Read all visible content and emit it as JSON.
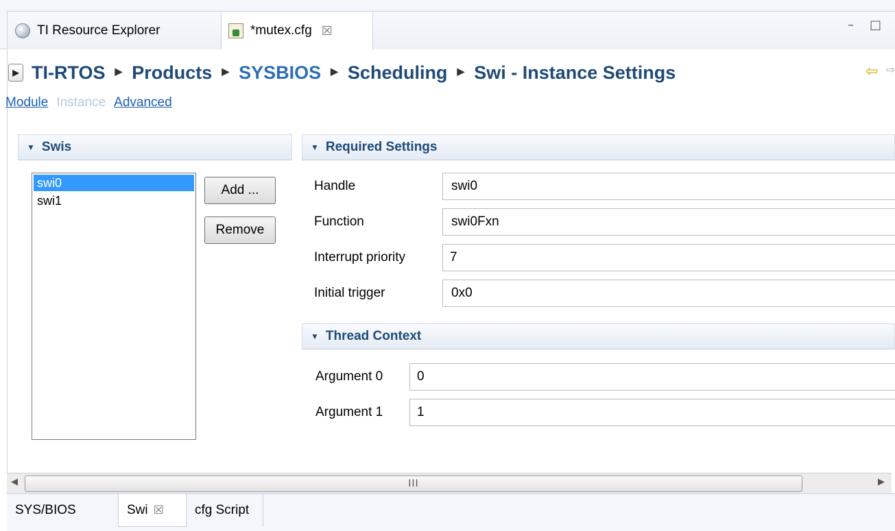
{
  "tabs": {
    "resource_explorer": "TI Resource Explorer",
    "mutex_cfg": "*mutex.cfg",
    "close_glyph": "☒",
    "minimize_glyph": "–",
    "maximize_glyph": "□"
  },
  "breadcrumb": {
    "items": [
      "TI-RTOS",
      "Products",
      "SYSBIOS",
      "Scheduling",
      "Swi - Instance Settings"
    ],
    "separator": "▶",
    "expander": "▶"
  },
  "nav_links": {
    "module": "Module",
    "instance": "Instance",
    "advanced": "Advanced"
  },
  "swis_section": {
    "title": "Swis",
    "items": [
      "swi0",
      "swi1"
    ],
    "selected_index": 0,
    "add_button": "Add ...",
    "remove_button": "Remove"
  },
  "required_settings": {
    "title": "Required Settings",
    "handle_label": "Handle",
    "handle_value": "swi0",
    "function_label": "Function",
    "function_value": "swi0Fxn",
    "priority_label": "Interrupt priority",
    "priority_value": "7",
    "trigger_label": "Initial trigger",
    "trigger_value": "0x0"
  },
  "thread_context": {
    "title": "Thread Context",
    "arg0_label": "Argument 0",
    "arg0_value": "0",
    "arg1_label": "Argument 1",
    "arg1_value": "1"
  },
  "scrollbar": {
    "grip": "III"
  },
  "bottom_tabs": {
    "sysbios": "SYS/BIOS",
    "swi": "Swi",
    "cfg_script": "cfg Script"
  },
  "colors": {
    "heading_blue": "#1f4a76",
    "link_blue": "#1a5fb4",
    "selection_blue": "#3399ff"
  }
}
